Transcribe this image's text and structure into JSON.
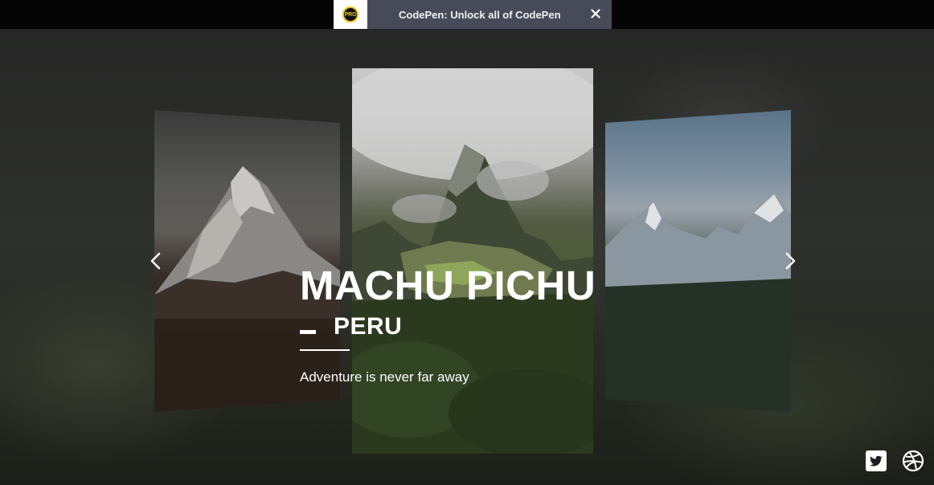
{
  "banner": {
    "badge_text": "PRO",
    "message": "CodePen: Unlock all of CodePen",
    "close_icon": "close-icon"
  },
  "slider": {
    "prev_icon": "chevron-left-icon",
    "next_icon": "chevron-right-icon",
    "active_slide": {
      "title": "MACHU PICHU",
      "subtitle": "PERU",
      "tagline": "Adventure is never far away"
    }
  },
  "social": [
    {
      "icon": "twitter-icon"
    },
    {
      "icon": "dribbble-icon"
    }
  ],
  "colors": {
    "banner_bg": "#050505",
    "promo_bg": "#474a58",
    "pro_badge": "#f3c316",
    "text": "#ffffff"
  }
}
